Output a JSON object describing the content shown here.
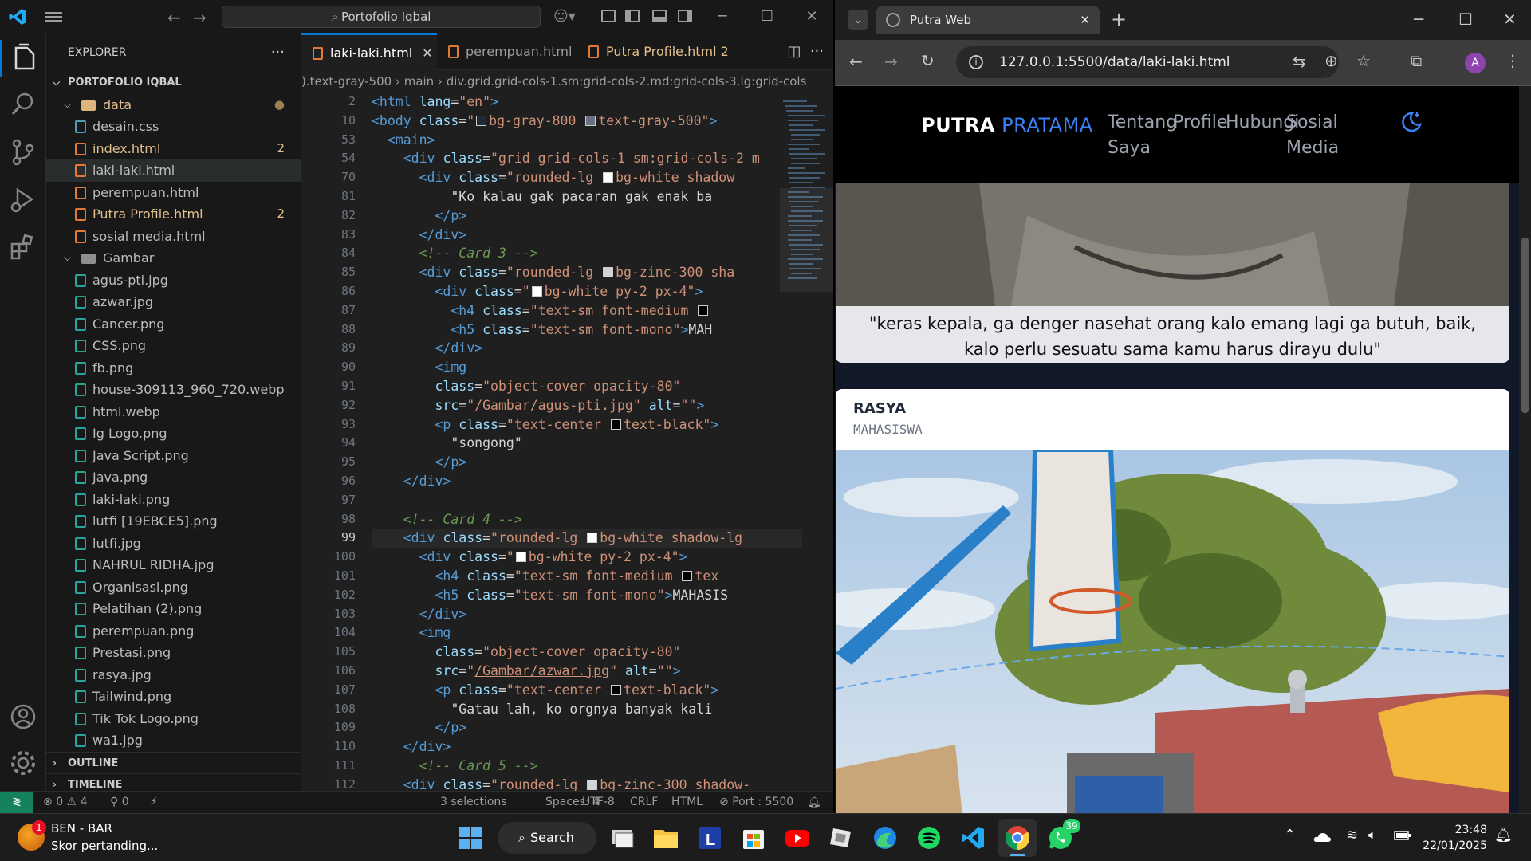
{
  "vscode": {
    "command_center": "Portofolio Iqbal",
    "explorer": {
      "title": "EXPLORER",
      "root": "PORTOFOLIO IQBAL",
      "folder_data": "data",
      "files_data": [
        {
          "name": "desain.css",
          "type": "css",
          "badge": ""
        },
        {
          "name": "index.html",
          "type": "html",
          "badge": "2"
        },
        {
          "name": "laki-laki.html",
          "type": "html",
          "badge": ""
        },
        {
          "name": "perempuan.html",
          "type": "html",
          "badge": ""
        },
        {
          "name": "Putra Profile.html",
          "type": "html",
          "badge": "2"
        },
        {
          "name": "sosial media.html",
          "type": "html",
          "badge": ""
        }
      ],
      "folder_gambar": "Gambar",
      "files_gambar": [
        "agus-pti.jpg",
        "azwar.jpg",
        "Cancer.png",
        "CSS.png",
        "fb.png",
        "house-309113_960_720.webp",
        "html.webp",
        "Ig Logo.png",
        "Java Script.png",
        "Java.png",
        "laki-laki.png",
        "lutfi [19EBCE5].png",
        "lutfi.jpg",
        "NAHRUL RIDHA.jpg",
        "Organisasi.png",
        "Pelatihan (2).png",
        "perempuan.png",
        "Prestasi.png",
        "rasya.jpg",
        "Tailwind.png",
        "Tik Tok Logo.png",
        "wa1.jpg"
      ],
      "outline": "OUTLINE",
      "timeline": "TIMELINE"
    },
    "tabs": [
      {
        "label": "laki-laki.html",
        "active": true,
        "badge": ""
      },
      {
        "label": "perempuan.html",
        "active": false,
        "badge": ""
      },
      {
        "label": "Putra Profile.html",
        "active": false,
        "badge": "2"
      }
    ],
    "breadcrumb": ").text-gray-500 › main › div.grid.grid-cols-1.sm:grid-cols-2.md:grid-cols-3.lg:grid-cols",
    "line_numbers": [
      "2",
      "10",
      "53",
      "54",
      "70",
      "81",
      "82",
      "83",
      "84",
      "85",
      "86",
      "87",
      "88",
      "89",
      "90",
      "91",
      "92",
      "93",
      "94",
      "95",
      "96",
      "97",
      "98",
      "99",
      "100",
      "101",
      "102",
      "103",
      "104",
      "105",
      "106",
      "107",
      "108",
      "109",
      "110",
      "111",
      "112"
    ],
    "status": {
      "errors": "0",
      "warnings": "4",
      "ports": "0",
      "selections": "3 selections",
      "spaces": "Spaces: 4",
      "encoding": "UTF-8",
      "eol": "CRLF",
      "language": "HTML",
      "port": "Port : 5500"
    }
  },
  "chrome": {
    "tab_title": "Putra Web",
    "url": "127.0.0.1:5500/data/laki-laki.html",
    "profile_initial": "A",
    "site": {
      "brand_bold": "PUTRA",
      "brand_accent": "PRATAMA",
      "nav": [
        {
          "line1": "Tentang",
          "line2": "Saya"
        },
        {
          "line1": "Profile",
          "line2": ""
        },
        {
          "line1": "Hubungi",
          "line2": ""
        },
        {
          "line1": "Sosial",
          "line2": "Media"
        }
      ],
      "card1_quote": "\"keras kepala, ga denger nasehat orang kalo emang lagi ga butuh, baik, kalo perlu sesuatu sama kamu harus dirayu dulu\"",
      "card2_name": "RASYA",
      "card2_role": "MAHASISWA"
    }
  },
  "taskbar": {
    "news_title": "BEN - BAR",
    "news_sub": "Skor pertanding...",
    "news_badge": "1",
    "search": "Search",
    "whatsapp_badge": "39",
    "time": "23:48",
    "date": "22/01/2025"
  },
  "colors": {
    "vscode_accent": "#0078d4",
    "modified": "#e2c08d",
    "html_icon": "#e37933",
    "brand_blue": "#3b82f6",
    "remote": "#16825d"
  }
}
